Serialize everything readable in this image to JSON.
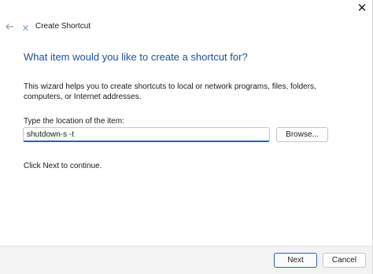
{
  "window": {
    "title": "Create Shortcut",
    "close_glyph": "✕"
  },
  "icons": {
    "back": "back-arrow-icon",
    "app": "shortcut-app-icon",
    "close": "close-icon"
  },
  "main": {
    "heading": "What item would you like to create a shortcut for?",
    "description": "This wizard helps you to create shortcuts to local or network programs, files, folders, computers, or Internet addresses.",
    "location_label": "Type the location of the item:",
    "location_value": "shutdown-s -t",
    "browse_label": "Browse...",
    "hint": "Click Next to continue."
  },
  "footer": {
    "next_label": "Next",
    "cancel_label": "Cancel"
  },
  "colors": {
    "heading": "#1f4f9c",
    "accent": "#2b63c0",
    "footer_bg": "#f3f3f3"
  }
}
